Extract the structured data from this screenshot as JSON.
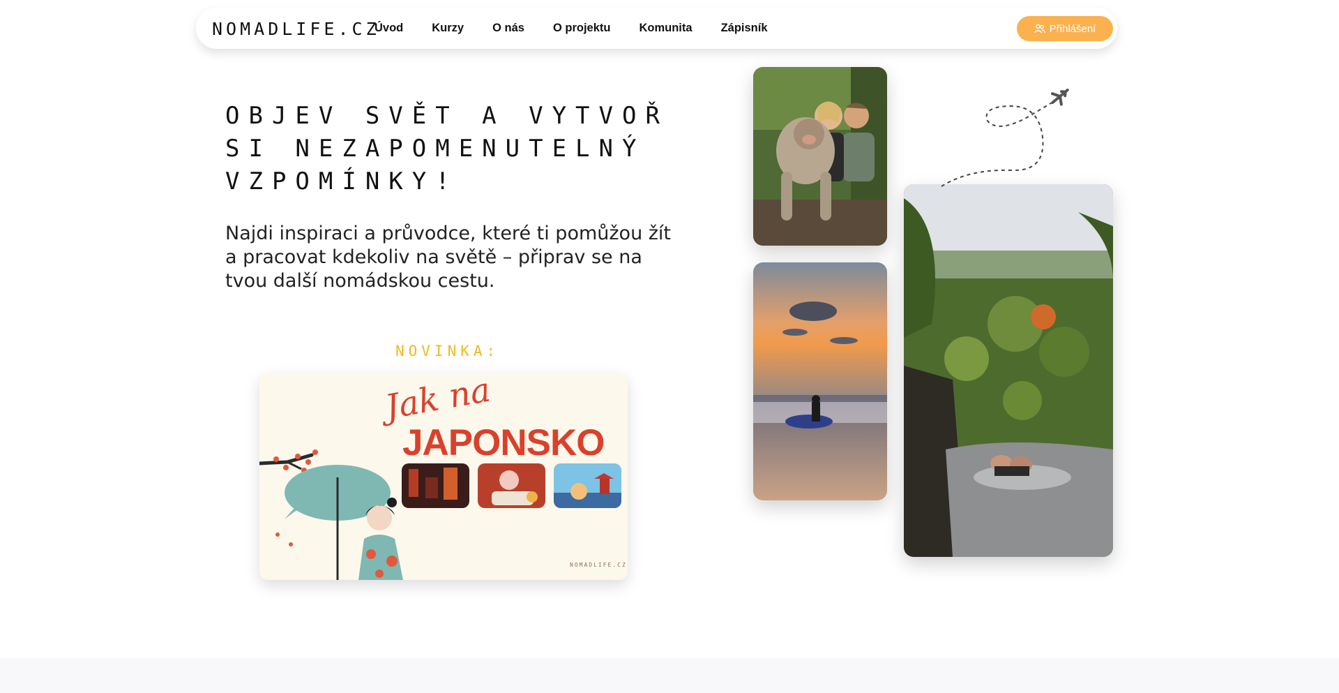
{
  "nav": {
    "logo": "NOMADLIFE.CZ",
    "links": [
      "Úvod",
      "Kurzy",
      "O nás",
      "O projektu",
      "Komunita",
      "Zápisník"
    ],
    "login_label": "Přihlášení"
  },
  "hero": {
    "headline": "Objev svět a vytvoř si nezapomenutelný vzpomínky!",
    "subtitle": "Najdi inspiraci a průvodce, které ti pomůžou žít a pracovat kdekoliv na světě – připrav se na tvou další nomádskou cestu."
  },
  "novinka": {
    "label": "NOVINKA:",
    "card_script": "Jak na",
    "card_title": "JAPONSKO",
    "card_brand": "NOMADLIFE.CZ"
  },
  "colors": {
    "accent": "#fbb14e",
    "novinka": "#f2b91e",
    "promo_red": "#d9412c",
    "promo_bg": "#fdf8ec"
  },
  "icons": [
    "users-icon",
    "airplane-icon"
  ]
}
